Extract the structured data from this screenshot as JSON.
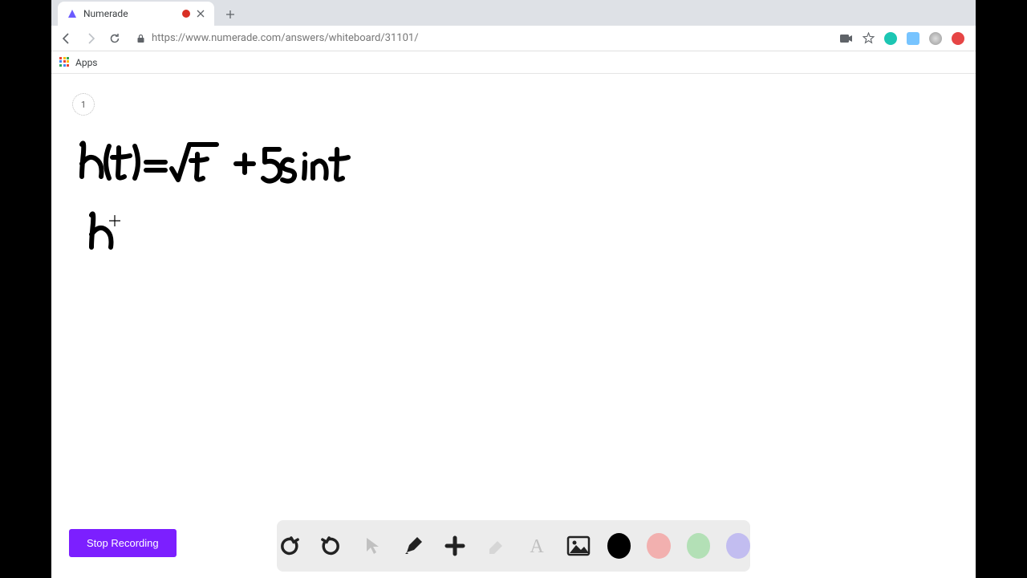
{
  "browser": {
    "tab": {
      "title": "Numerade",
      "favicon_color_a": "#5a4fff",
      "favicon_color_b": "#9a7dff"
    },
    "url": "https://www.numerade.com/answers/whiteboard/31101/",
    "bookmarks": {
      "apps_label": "Apps"
    },
    "ext_colors": {
      "teal": "#1cc6b3",
      "blue": "#4aa8ff",
      "gray": "#8a8f99",
      "red": "#e64545"
    }
  },
  "page": {
    "badge": "1",
    "stop_label": "Stop Recording"
  },
  "toolbar_icons": {
    "undo": "undo",
    "redo": "redo",
    "pointer": "pointer",
    "pencil": "pencil",
    "plus": "plus",
    "eraser": "eraser",
    "text": "text",
    "image": "image"
  },
  "handwriting": {
    "line1": "h(t) = √t + 5 sin t",
    "line2": "h'"
  },
  "chart_data": null
}
